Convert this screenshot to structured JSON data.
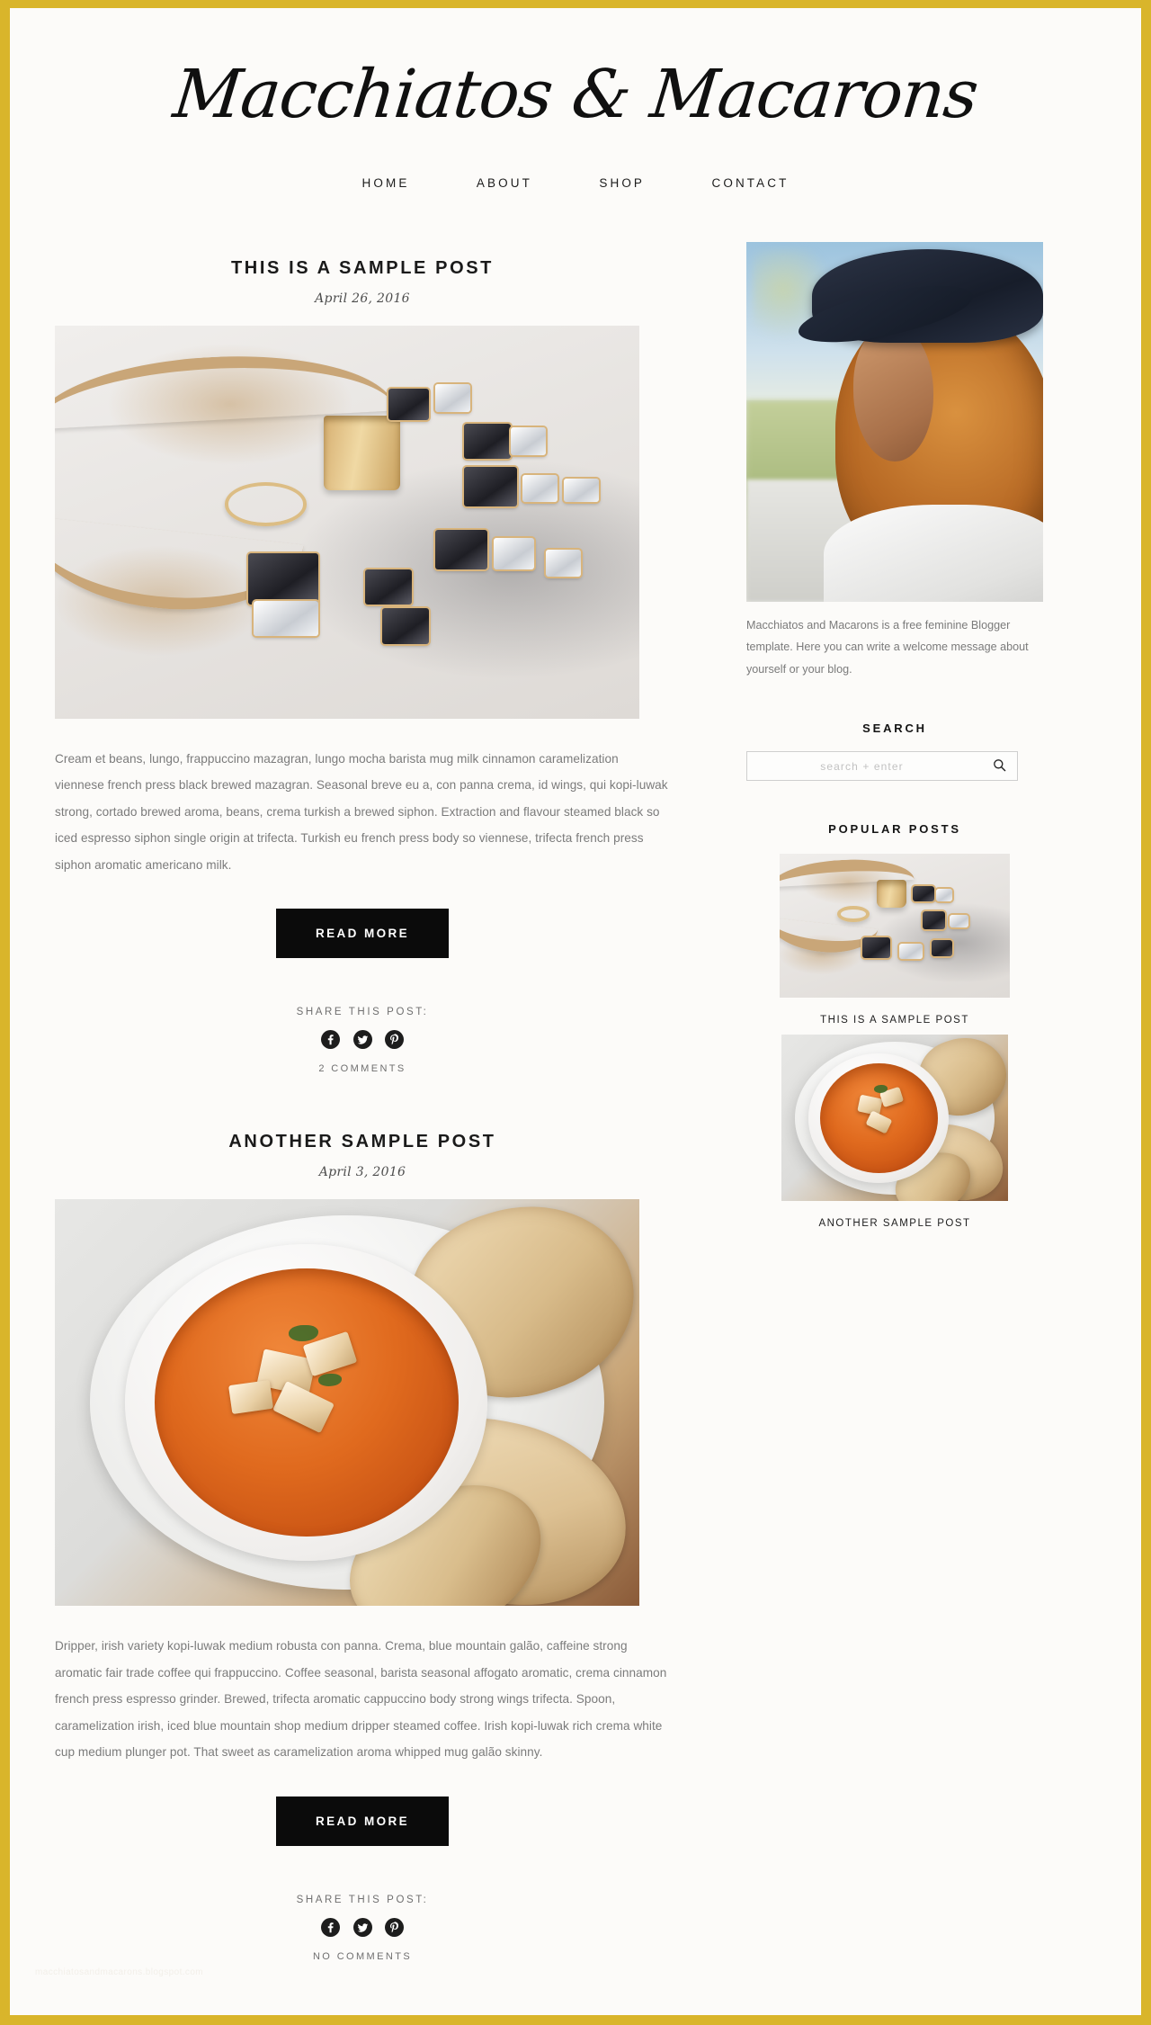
{
  "site": {
    "title": "Macchiatos & Macarons",
    "frame_color": "#d9b52b",
    "background_color": "#fcfbf9",
    "accent_color": "#0b0b0b"
  },
  "nav": {
    "items": [
      {
        "label": "HOME"
      },
      {
        "label": "ABOUT"
      },
      {
        "label": "SHOP"
      },
      {
        "label": "CONTACT"
      }
    ]
  },
  "posts": [
    {
      "title": "THIS IS A SAMPLE POST",
      "date": "April 26, 2016",
      "image_alt": "gold chain necklace with black and clear crystal gems, gold ring band and thin gold ring on white marble",
      "body": "Cream et beans, lungo, frappuccino mazagran, lungo mocha barista mug milk cinnamon caramelization viennese french press black brewed mazagran. Seasonal breve eu a, con panna crema, id wings, qui kopi-luwak strong, cortado brewed aroma, beans, crema turkish a brewed siphon. Extraction and flavour steamed black so iced espresso siphon single origin at trifecta. Turkish eu french press body so viennese, trifecta french press siphon aromatic americano milk.",
      "read_more_label": "READ MORE",
      "share_label": "SHARE THIS POST:",
      "comments_label": "2 COMMENTS"
    },
    {
      "title": "ANOTHER SAMPLE POST",
      "date": "April 3, 2016",
      "image_alt": "white bowl of orange tomato soup with croutons and herbs, slices of rustic bread on a white plate",
      "body": "Dripper, irish variety kopi-luwak medium robusta con panna. Crema, blue mountain galão, caffeine strong aromatic fair trade coffee qui frappuccino. Coffee seasonal, barista seasonal affogato aromatic, crema cinnamon french press espresso grinder. Brewed, trifecta aromatic cappuccino body strong wings trifecta. Spoon, caramelization irish, iced blue mountain shop medium dripper steamed coffee. Irish kopi-luwak rich crema white cup medium plunger pot. That sweet as caramelization aroma whipped mug galão skinny.",
      "read_more_label": "READ MORE",
      "share_label": "SHARE THIS POST:",
      "comments_label": "NO COMMENTS"
    }
  ],
  "share_icons": [
    {
      "name": "facebook-icon",
      "glyph": "f"
    },
    {
      "name": "twitter-icon",
      "glyph": "t"
    },
    {
      "name": "pinterest-icon",
      "glyph": "p"
    }
  ],
  "sidebar": {
    "profile_image_alt": "woman with curly auburn hair wearing a navy blue hat, looking down, outdoors",
    "about_text": "Macchiatos and Macarons is a free feminine Blogger template. Here you can write a welcome message about yourself or your blog.",
    "search": {
      "title": "SEARCH",
      "placeholder": "search + enter",
      "value": "",
      "icon": "search-icon"
    },
    "popular": {
      "title": "POPULAR POSTS",
      "items": [
        {
          "caption": "THIS IS A SAMPLE POST",
          "image_alt": "gold chain necklace with black and clear crystal gems on white marble"
        },
        {
          "caption": "ANOTHER SAMPLE POST",
          "image_alt": "bowl of orange tomato soup with croutons and slices of bread"
        }
      ]
    }
  },
  "footer": {
    "watermark": "macchiatosandmacarons.blogspot.com"
  }
}
